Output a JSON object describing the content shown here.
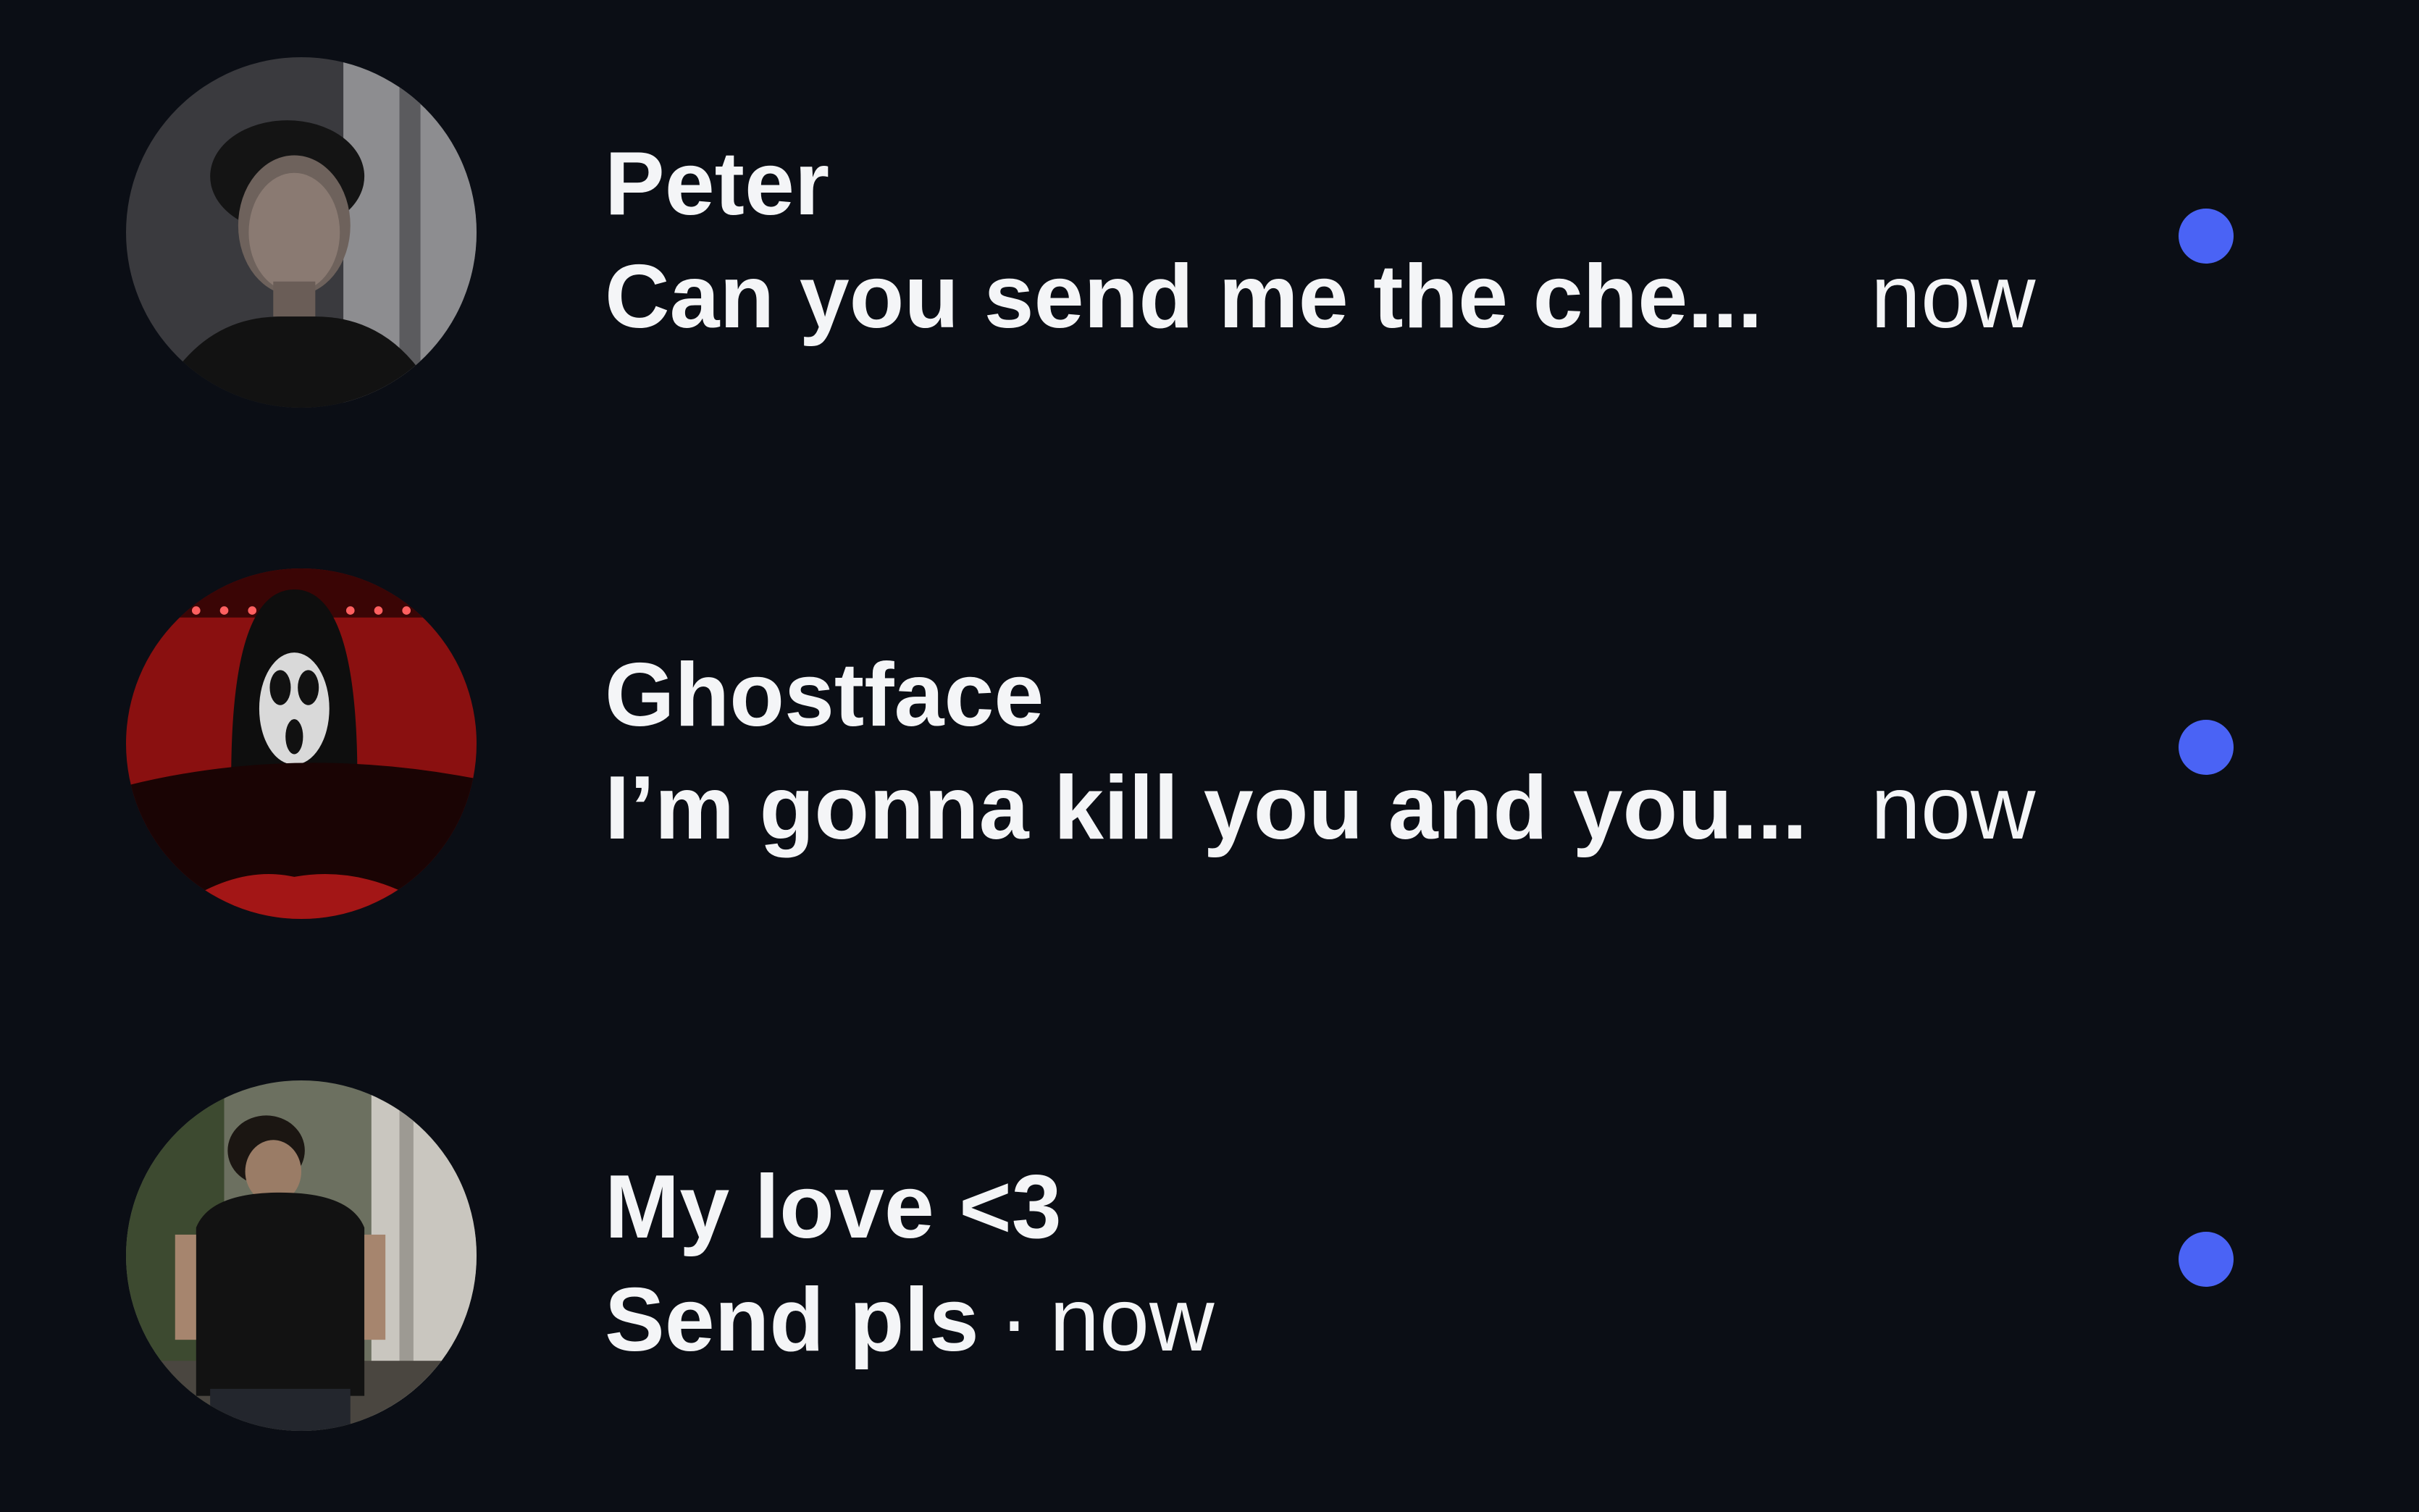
{
  "colors": {
    "background": "#0b0e15",
    "text": "#f4f5f7",
    "unread_dot": "#4a63f5"
  },
  "conversations": [
    {
      "name": "Peter",
      "preview": "Can you send me the che...",
      "time": "now",
      "unread": true,
      "avatar_icon": "profile-photo-peter"
    },
    {
      "name": "Ghostface",
      "preview": "I’m gonna kill you and you...",
      "time": "now",
      "unread": true,
      "avatar_icon": "profile-photo-ghostface"
    },
    {
      "name": "My love <3",
      "preview": "Send pls",
      "separator": "·",
      "time": "now",
      "unread": true,
      "avatar_icon": "profile-photo-my-love"
    }
  ]
}
